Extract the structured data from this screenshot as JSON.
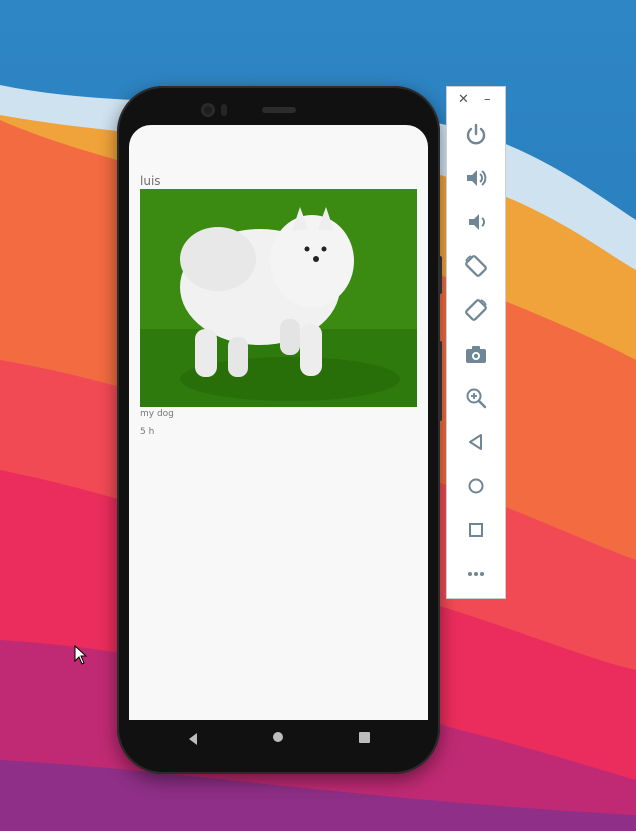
{
  "post": {
    "user": "luis",
    "caption": "my dog",
    "time": "5 h"
  },
  "toolbar": {
    "close_label": "✕",
    "minimize_label": "–",
    "buttons": [
      "power-icon",
      "volume-up-icon",
      "volume-down-icon",
      "rotate-left-icon",
      "rotate-right-icon",
      "camera-icon",
      "zoom-icon",
      "back-icon",
      "home-icon",
      "overview-icon",
      "more-icon"
    ]
  },
  "colors": {
    "toolbar_icon": "#6e8695",
    "screen_bg": "#f8f8f8",
    "grass": "#3b8a12",
    "nav_icon": "#bdbdbd"
  }
}
